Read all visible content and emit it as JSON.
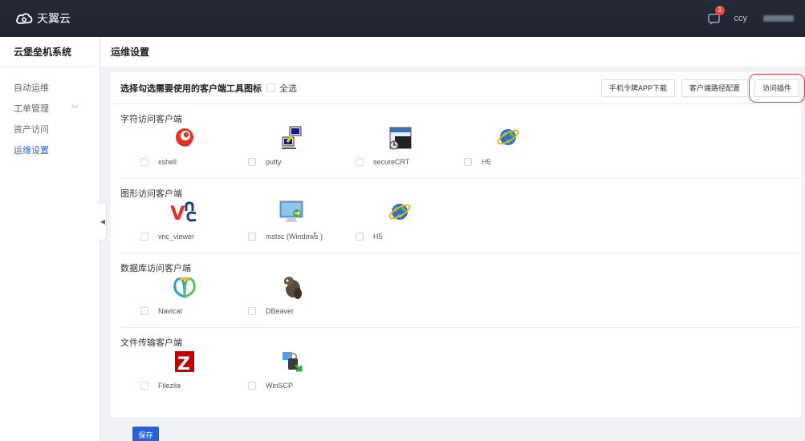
{
  "topbar": {
    "logo_text": "天翼云",
    "user_name": "ccy",
    "notification_count": "3"
  },
  "sidebar": {
    "system_title": "云堡垒机系统",
    "items": [
      {
        "label": "自动运维",
        "active": false
      },
      {
        "label": "工单管理",
        "active": false,
        "expandable": true
      },
      {
        "label": "资产访问",
        "active": false
      },
      {
        "label": "运维设置",
        "active": true
      }
    ]
  },
  "page": {
    "title": "运维设置"
  },
  "toolbar": {
    "title": "选择勾选需要使用的客户端工具图标",
    "select_all": "全选",
    "buttons": [
      "手机令牌APP下载",
      "客户端路径配置",
      "访问插件"
    ]
  },
  "sections": [
    {
      "title": "字符访问客户端",
      "items": [
        {
          "label": "xshell",
          "icon": "xshell-icon"
        },
        {
          "label": "putty",
          "icon": "putty-icon"
        },
        {
          "label": "secureCRT",
          "icon": "securecrt-icon"
        },
        {
          "label": "H5",
          "icon": "globe-icon"
        }
      ]
    },
    {
      "title": "图形访问客户端",
      "items": [
        {
          "label": "vnc_viewer",
          "icon": "vnc-icon"
        },
        {
          "label": "mstsc (Windows )",
          "icon": "mstsc-icon"
        },
        {
          "label": "H5",
          "icon": "globe-icon"
        }
      ]
    },
    {
      "title": "数据库访问客户端",
      "items": [
        {
          "label": "Navicat",
          "icon": "navicat-icon"
        },
        {
          "label": "DBeaver",
          "icon": "dbeaver-icon"
        }
      ]
    },
    {
      "title": "文件传输客户端",
      "items": [
        {
          "label": "Filezila",
          "icon": "filezilla-icon"
        },
        {
          "label": "WinSCP",
          "icon": "winscp-icon"
        }
      ]
    }
  ],
  "footer": {
    "save_label": "保存"
  },
  "colors": {
    "topbar": "#1f2937",
    "accent": "#2a62d4",
    "highlight_box": "#e8393f"
  }
}
